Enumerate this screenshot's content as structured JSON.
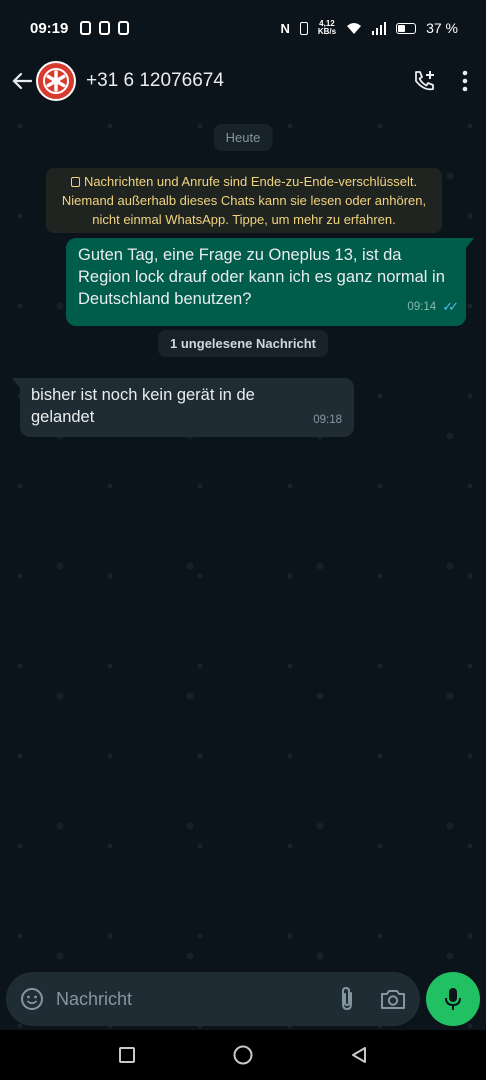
{
  "status": {
    "time": "09:19",
    "network_speed": "4,12\nKB/s",
    "battery": "37 %",
    "battery_level": 0.37
  },
  "header": {
    "contact": "+31 6 12076674"
  },
  "chat": {
    "date_label": "Heute",
    "encryption_notice": "Nachrichten und Anrufe sind Ende-zu-Ende-verschlüsselt. Niemand außerhalb dieses Chats kann sie lesen oder anhören, nicht einmal WhatsApp. Tippe, um mehr zu erfahren.",
    "outgoing": {
      "text": "Guten Tag, eine Frage zu Oneplus 13, ist da Region lock drauf oder kann ich es ganz normal in Deutschland benutzen?",
      "time": "09:14"
    },
    "unread_label": "1 ungelesene Nachricht",
    "incoming": {
      "text": "bisher ist noch kein gerät in de gelandet",
      "time": "09:18"
    }
  },
  "composer": {
    "placeholder": "Nachricht"
  },
  "colors": {
    "accent": "#21c063",
    "outgoing_bubble": "#005c4b",
    "incoming_bubble": "#202c33"
  }
}
